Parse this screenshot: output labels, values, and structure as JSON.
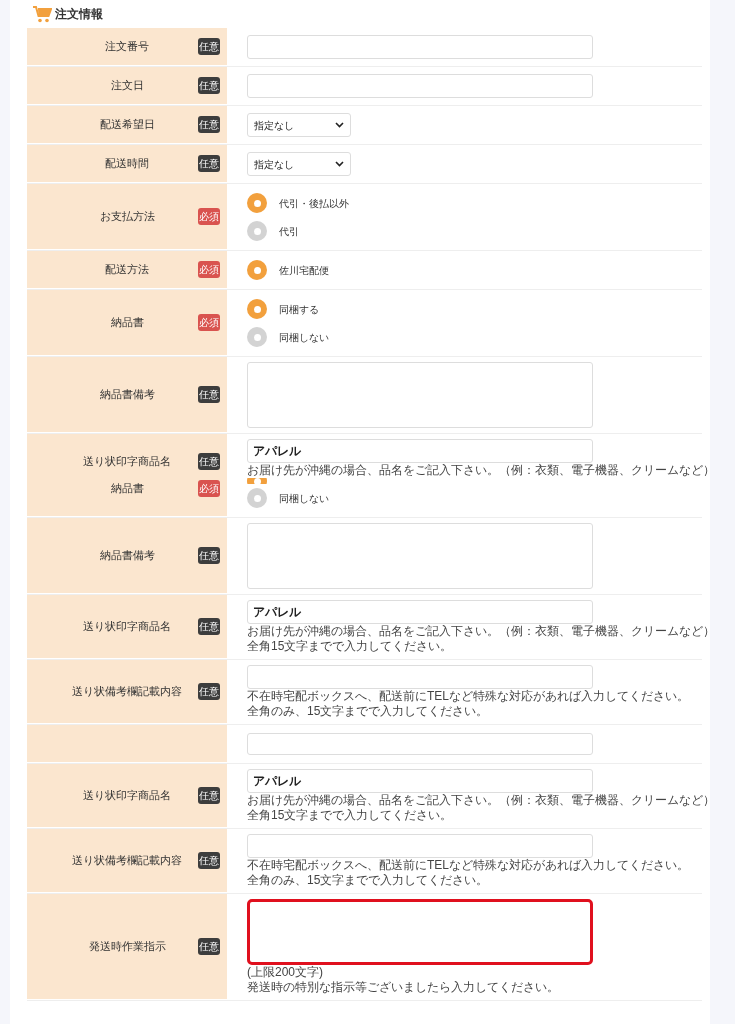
{
  "section": {
    "title": "注文情報"
  },
  "rows": [
    {
      "labels": [
        {
          "text": "注文番号",
          "badge": {
            "text": "任意",
            "kind": "optional"
          }
        }
      ],
      "fields": [
        {
          "kind": "text"
        }
      ]
    },
    {
      "labels": [
        {
          "text": "注文日",
          "badge": {
            "text": "任意",
            "kind": "optional"
          }
        }
      ],
      "fields": [
        {
          "kind": "text"
        }
      ]
    },
    {
      "labels": [
        {
          "text": "配送希望日",
          "badge": {
            "text": "任意",
            "kind": "optional"
          }
        }
      ],
      "fields": [
        {
          "kind": "select",
          "value": "指定なし"
        }
      ]
    },
    {
      "labels": [
        {
          "text": "配送時間",
          "badge": {
            "text": "任意",
            "kind": "optional"
          }
        }
      ],
      "fields": [
        {
          "kind": "select",
          "value": "指定なし"
        }
      ]
    },
    {
      "labels": [
        {
          "text": "お支払方法",
          "badge": {
            "text": "必須",
            "kind": "required"
          }
        }
      ],
      "fields": [
        {
          "kind": "radios",
          "options": [
            {
              "label": "代引・後払以外",
              "selected": true
            },
            {
              "label": "代引",
              "selected": false
            }
          ]
        }
      ]
    },
    {
      "labels": [
        {
          "text": "配送方法",
          "badge": {
            "text": "必須",
            "kind": "required"
          }
        }
      ],
      "fields": [
        {
          "kind": "radios",
          "options": [
            {
              "label": "佐川宅配便",
              "selected": true
            }
          ]
        }
      ]
    },
    {
      "labels": [
        {
          "text": "納品書",
          "badge": {
            "text": "必須",
            "kind": "required"
          }
        }
      ],
      "fields": [
        {
          "kind": "radios",
          "options": [
            {
              "label": "同梱する",
              "selected": true
            },
            {
              "label": "同梱しない",
              "selected": false
            }
          ]
        }
      ]
    },
    {
      "labels": [
        {
          "text": "納品書備考",
          "badge": {
            "text": "任意",
            "kind": "optional"
          }
        }
      ],
      "fields": [
        {
          "kind": "textarea",
          "highlighted": false
        }
      ]
    },
    {
      "labels": [
        {
          "text": "送り状印字商品名",
          "badge": {
            "text": "任意",
            "kind": "optional"
          }
        },
        {
          "text": "納品書",
          "badge": {
            "text": "必須",
            "kind": "required"
          }
        }
      ],
      "fields": [
        {
          "kind": "text",
          "value": "アパレル",
          "notes": [
            "お届け先が沖縄の場合、品名をご記入下さい。（例：衣類、電子機器、クリームなど）"
          ]
        },
        {
          "kind": "radios",
          "options": [
            {
              "selected": true
            },
            {
              "label": "同梱しない",
              "selected": false
            }
          ]
        }
      ]
    },
    {
      "labels": [
        {
          "text": "納品書備考",
          "badge": {
            "text": "任意",
            "kind": "optional"
          }
        }
      ],
      "fields": [
        {
          "kind": "textarea",
          "highlighted": false
        }
      ]
    },
    {
      "labels": [
        {
          "text": "送り状印字商品名",
          "badge": {
            "text": "任意",
            "kind": "optional"
          }
        }
      ],
      "fields": [
        {
          "kind": "text",
          "value": "アパレル",
          "notes": [
            "お届け先が沖縄の場合、品名をご記入下さい。（例：衣類、電子機器、クリームなど）",
            "全角15文字までで入力してください。"
          ]
        }
      ]
    },
    {
      "labels": [
        {
          "text": "送り状備考欄記載内容",
          "badge": {
            "text": "任意",
            "kind": "optional"
          }
        }
      ],
      "fields": [
        {
          "kind": "text",
          "notes": [
            "不在時宅配ボックスへ、配送前にTELなど特殊な対応があれば入力してください。",
            "全角のみ、15文字までで入力してください。"
          ]
        }
      ]
    },
    {
      "labels": [],
      "fields": [
        {
          "kind": "short_textarea",
          "highlighted": false
        }
      ]
    },
    {
      "labels": [
        {
          "text": "送り状印字商品名",
          "badge": {
            "text": "任意",
            "kind": "optional"
          }
        }
      ],
      "fields": [
        {
          "kind": "text",
          "value": "アパレル",
          "notes": [
            "お届け先が沖縄の場合、品名をご記入下さい。（例：衣類、電子機器、クリームなど）",
            "全角15文字までで入力してください。"
          ]
        }
      ]
    },
    {
      "labels": [
        {
          "text": "送り状備考欄記載内容",
          "badge": {
            "text": "任意",
            "kind": "optional"
          }
        }
      ],
      "fields": [
        {
          "kind": "text",
          "notes": [
            "不在時宅配ボックスへ、配送前にTELなど特殊な対応があれば入力してください。",
            "全角のみ、15文字までで入力してください。"
          ]
        }
      ]
    },
    {
      "labels": [
        {
          "text": "発送時作業指示",
          "badge": {
            "text": "任意",
            "kind": "optional"
          }
        }
      ],
      "fields": [
        {
          "kind": "textarea",
          "highlighted": true,
          "notes": [
            "(上限200文字)",
            "発送時の特別な指示等ございましたら入力してください。"
          ]
        }
      ]
    }
  ]
}
